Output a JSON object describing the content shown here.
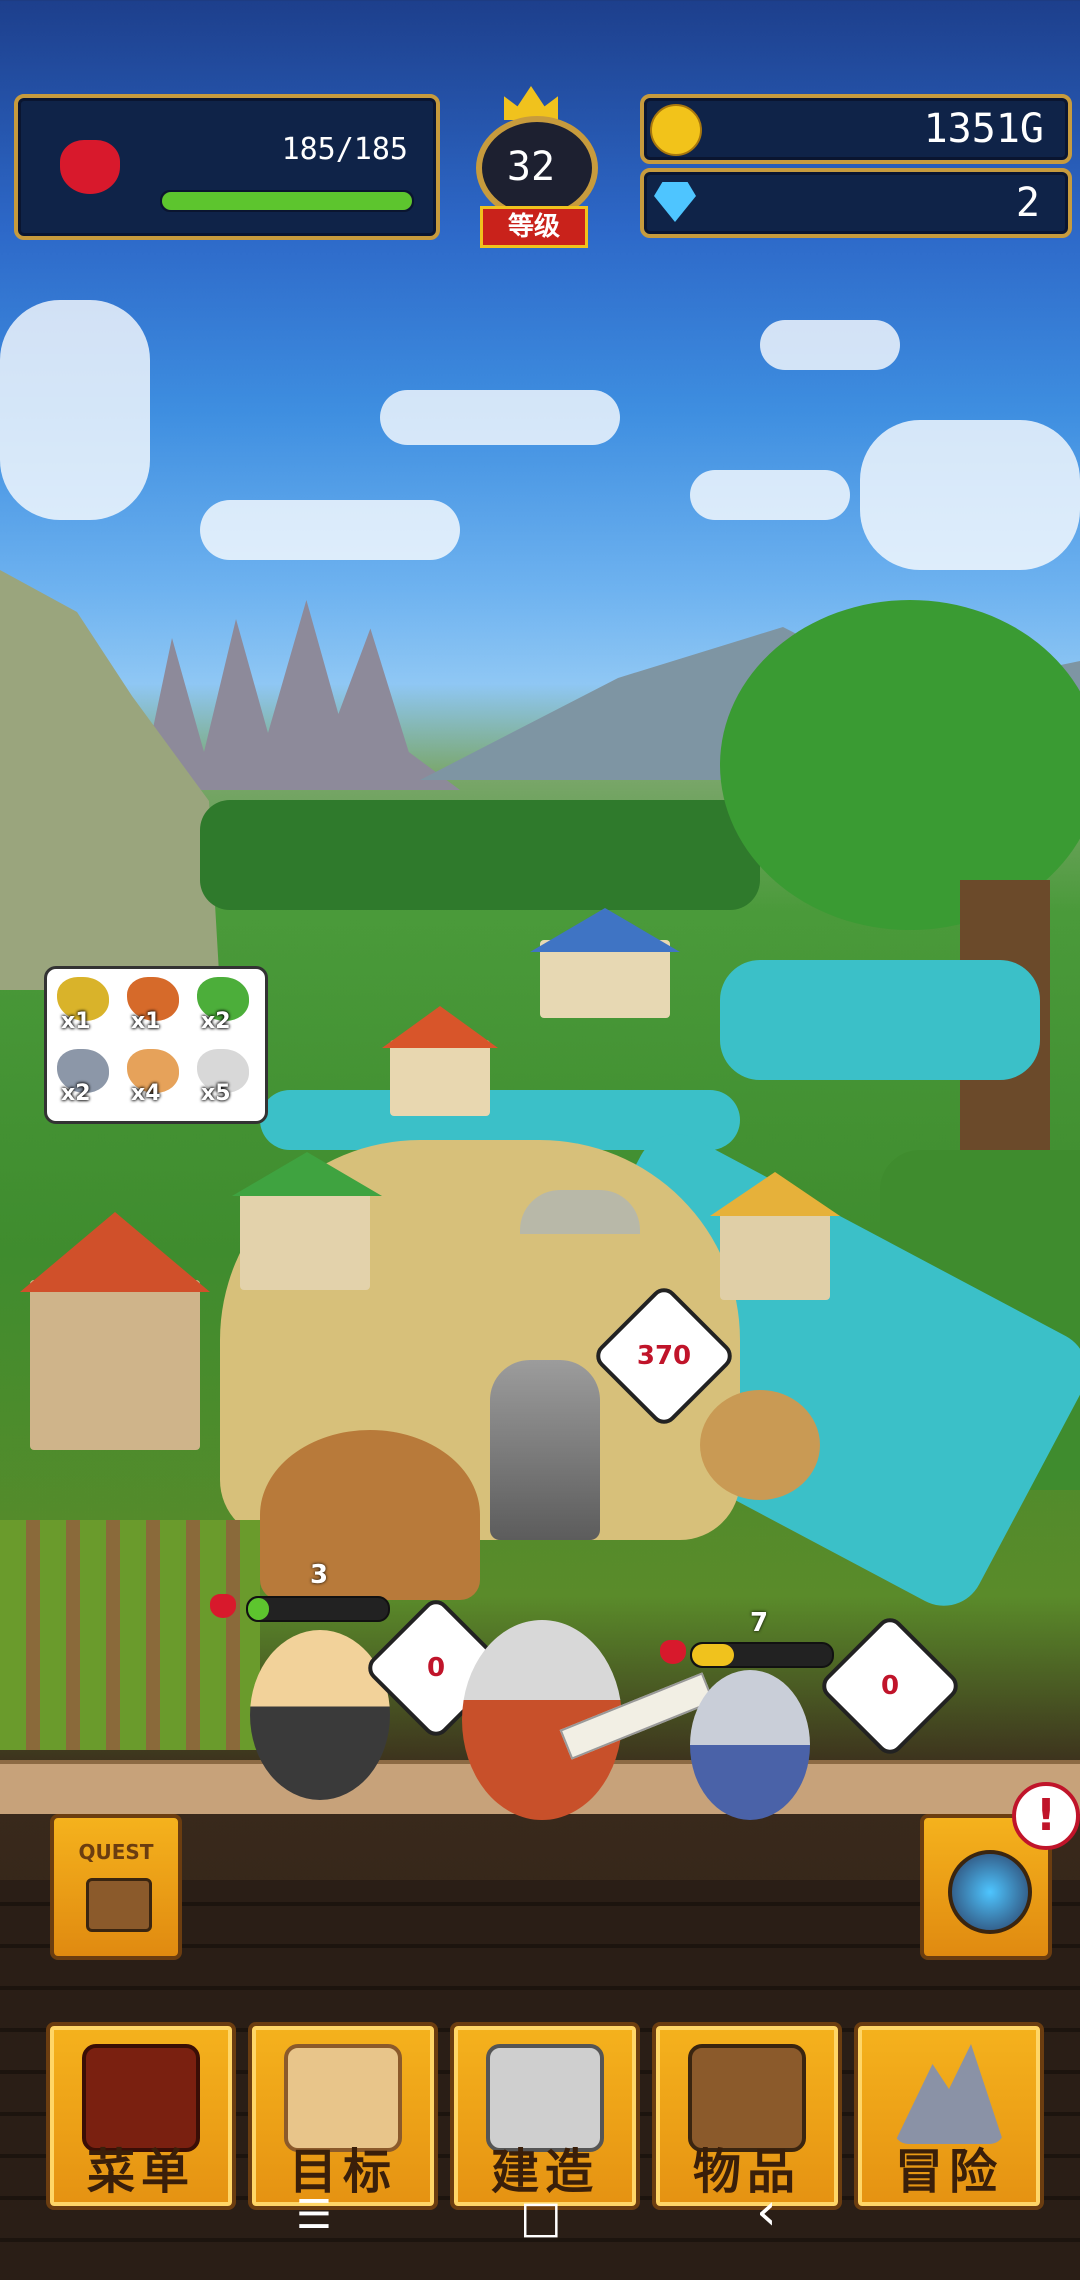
{
  "hud": {
    "hp_text": "185/185",
    "hp_fraction": 1.0,
    "level_value": "32",
    "level_label": "等级",
    "gold_text": "1351G",
    "gems_text": "2"
  },
  "resources": [
    {
      "icon": "gold-ore-icon",
      "count": "x1",
      "color": "#d9b32a"
    },
    {
      "icon": "copper-ore-icon",
      "count": "x1",
      "color": "#d66a2a"
    },
    {
      "icon": "green-block-icon",
      "count": "x2",
      "color": "#4cae3a"
    },
    {
      "icon": "stone-ore-icon",
      "count": "x2",
      "color": "#8c97a8"
    },
    {
      "icon": "sand-ore-icon",
      "count": "x4",
      "color": "#e6a25a"
    },
    {
      "icon": "silver-ore-icon",
      "count": "x5",
      "color": "#d8d8d8"
    }
  ],
  "scene": {
    "statue_hp_bubble": "370",
    "maid_level": "3",
    "maid_hp_fraction": 0.15,
    "maid_bubble": "0",
    "knight_level": "7",
    "knight_hp_fraction": 0.3,
    "knight_bubble": "0"
  },
  "side_buttons": {
    "quest_label": "QUEST",
    "alert_mark": "!"
  },
  "nav": [
    {
      "label": "菜单",
      "icon": "menu-grid-icon"
    },
    {
      "label": "目标",
      "icon": "quest-scroll-icon"
    },
    {
      "label": "建造",
      "icon": "castle-icon"
    },
    {
      "label": "物品",
      "icon": "items-chest-icon"
    },
    {
      "label": "冒险",
      "icon": "mountain-icon"
    }
  ],
  "system_nav": {
    "menu": "☰",
    "home": "□",
    "back": "‹"
  },
  "colors": {
    "hud_border": "#c79b3d",
    "hp_green": "#5dc52e",
    "button_orange": "#f0a51a",
    "heart_red": "#d8192c"
  }
}
